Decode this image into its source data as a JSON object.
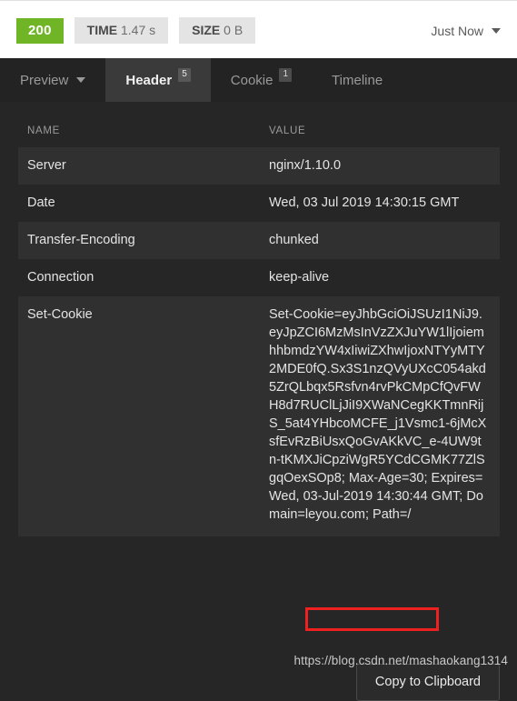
{
  "status_bar": {
    "status_code": "200",
    "status_color": "#70b526",
    "time_label": "TIME",
    "time_value": "1.47 s",
    "size_label": "SIZE",
    "size_value": "0 B",
    "timestamp": "Just Now",
    "timestamp_caret": "chevron-down-icon"
  },
  "tabs": [
    {
      "label": "Preview",
      "badge": "",
      "active": false,
      "has_caret": true
    },
    {
      "label": "Header",
      "badge": "5",
      "active": true,
      "has_caret": false
    },
    {
      "label": "Cookie",
      "badge": "1",
      "active": false,
      "has_caret": false
    },
    {
      "label": "Timeline",
      "badge": "",
      "active": false,
      "has_caret": false
    }
  ],
  "table": {
    "columns": [
      "NAME",
      "VALUE"
    ],
    "rows": [
      {
        "name": "Server",
        "value": "nginx/1.10.0"
      },
      {
        "name": "Date",
        "value": "Wed, 03 Jul 2019 14:30:15 GMT"
      },
      {
        "name": "Transfer-Encoding",
        "value": "chunked"
      },
      {
        "name": "Connection",
        "value": "keep-alive"
      },
      {
        "name": "Set-Cookie",
        "value": "Set-Cookie=eyJhbGciOiJSUzI1NiJ9.eyJpZCI6MzMsInVzZXJuYW1lIjoiemhhbmdzYW4xIiwiZXhwIjoxNTYyMTY2MDE0fQ.Sx3S1nzQVyUXcC054akd5ZrQLbqx5Rsfvn4rvPkCMpCfQvFWH8d7RUClLjJiI9XWaNCegKKTmnRijS_5at4YHbcoMCFE_j1Vsmc1-6jMcXsfEvRzBiUsxQoGvAKkVC_e-4UW9tn-tKMXJiCpziWgR5YCdCGMK77ZlSgqOexSOp8; Max-Age=30; Expires=Wed, 03-Jul-2019 14:30:44 GMT; Domain=leyou.com; Path=/"
      }
    ]
  },
  "annotation": {
    "highlight_text": "Domain=leyou.com;",
    "color": "#ef2020"
  },
  "copy_button": {
    "label": "Copy to Clipboard"
  },
  "watermark": {
    "text": "https://blog.csdn.net/mashaokang1314"
  }
}
